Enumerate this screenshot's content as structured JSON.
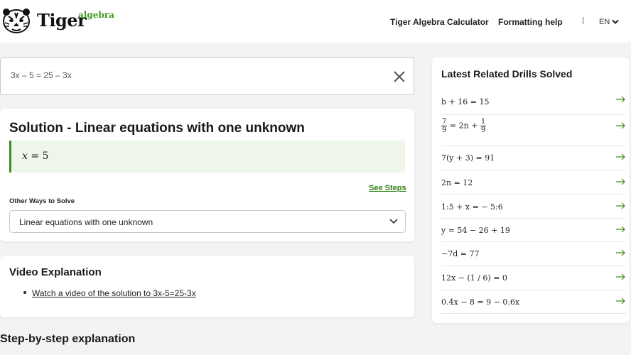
{
  "header": {
    "brand_name": "Tiger",
    "brand_suffix": "algebra",
    "nav": {
      "calculator": "Tiger Algebra Calculator",
      "formatting_help": "Formatting help",
      "language": "EN"
    }
  },
  "input": {
    "value": "3x – 5 = 25 – 3x"
  },
  "solution": {
    "title": "Solution - Linear equations with one unknown",
    "answer_var": "x",
    "answer_rest": " = 5",
    "see_steps": "See Steps",
    "other_ways_label": "Other Ways to Solve",
    "method_selected": "Linear equations with one unknown"
  },
  "video": {
    "title": "Video Explanation",
    "link": "Watch a video of the solution to 3x-5=25-3x"
  },
  "steps": {
    "title": "Step-by-step explanation"
  },
  "drills": {
    "title": "Latest Related Drills Solved",
    "items": [
      {
        "eq": "b + 16 = 15"
      },
      {
        "pre": "",
        "num1": "7",
        "den1": "9",
        "mid": " = 2n + ",
        "num2": "1",
        "den2": "9"
      },
      {
        "eq": " 7(y + 3) = 91"
      },
      {
        "eq": "2n = 12"
      },
      {
        "eq": "1:5 + x =  − 5:6"
      },
      {
        "eq": "y = 54 − 26 + 19"
      },
      {
        "eq": "−7d = 77"
      },
      {
        "eq": " 12x − (1 / 6) = 0"
      },
      {
        "eq": "0.4x − 8 = 9 − 0.6x"
      }
    ]
  },
  "colors": {
    "accent_green": "#3a8d1e",
    "answer_bg": "#eef6ea",
    "link_green": "#2e7d12"
  }
}
